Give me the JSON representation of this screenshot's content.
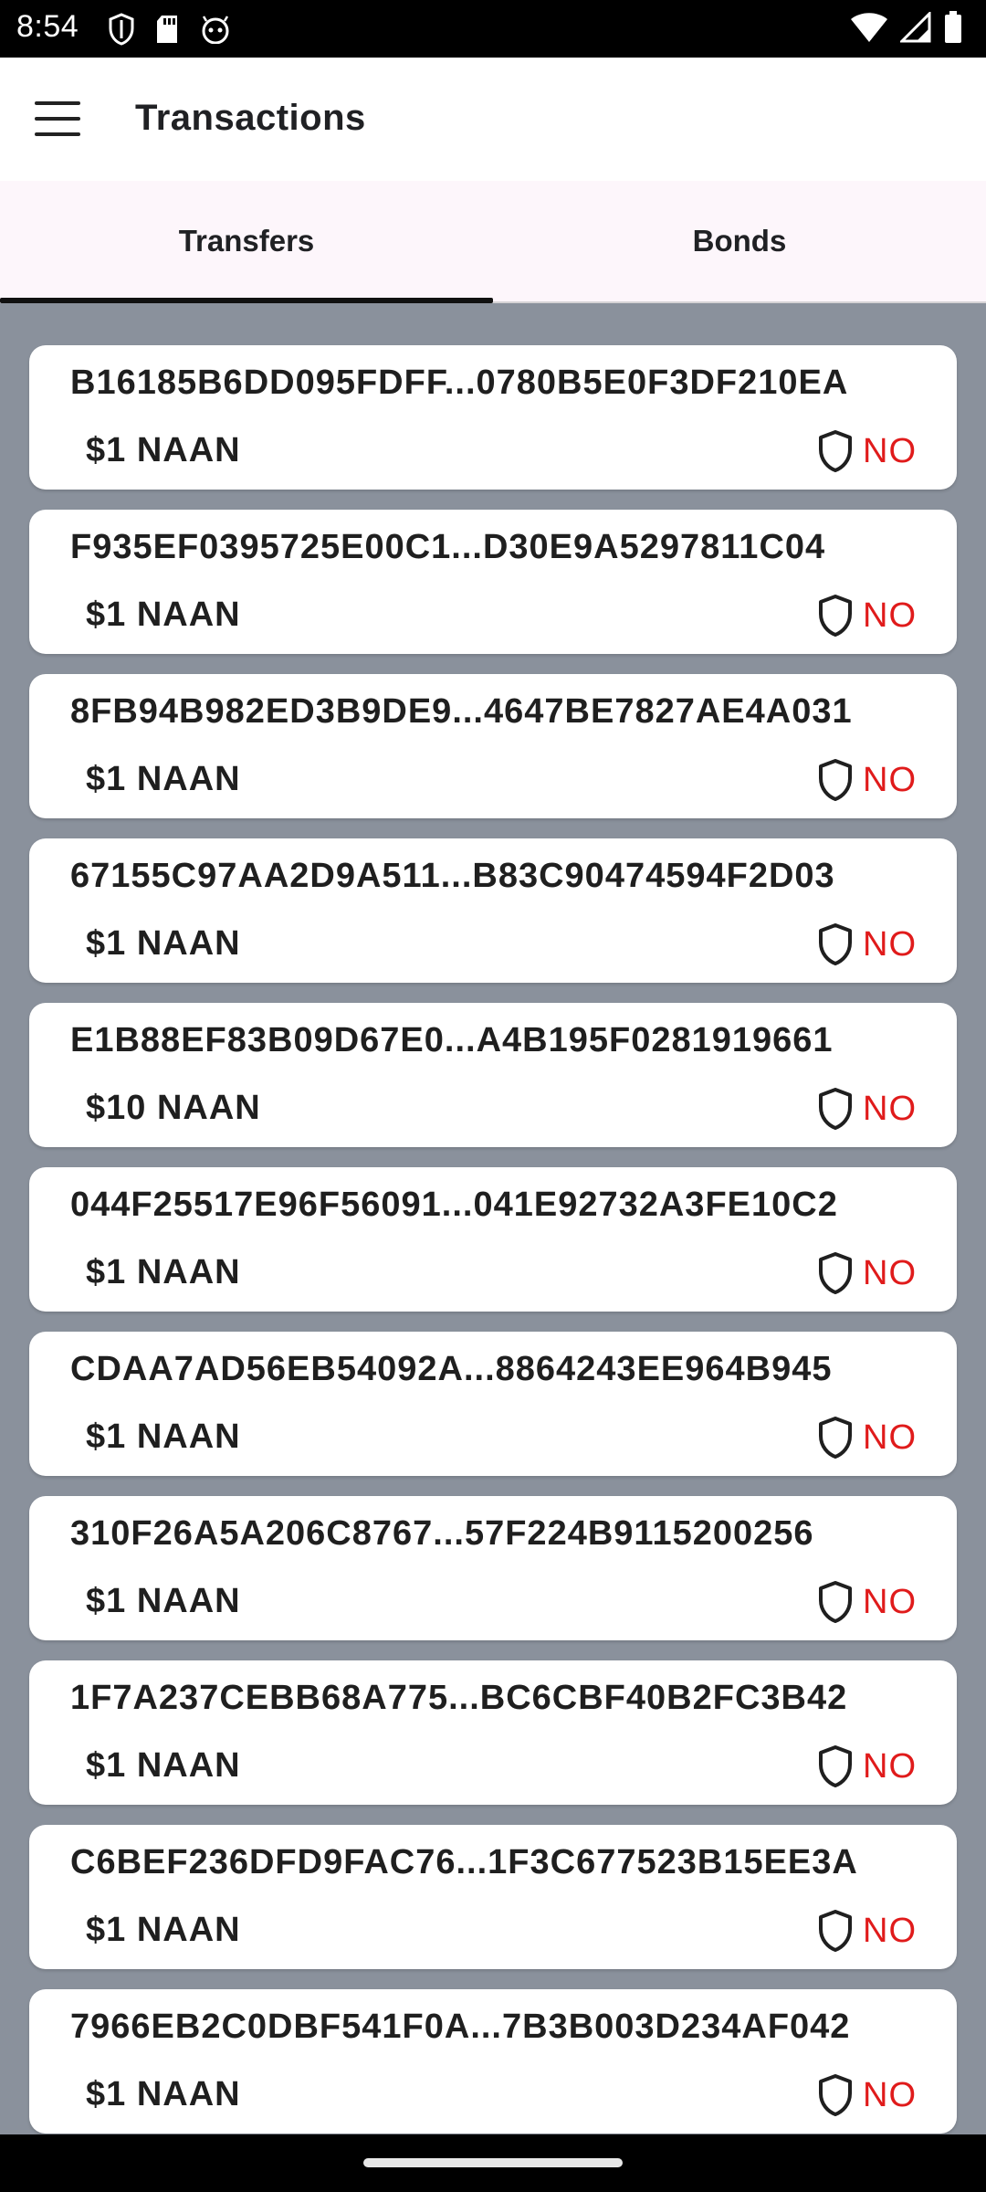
{
  "status_bar": {
    "time": "8:54"
  },
  "app_bar": {
    "title": "Transactions"
  },
  "tabs": [
    {
      "label": "Transfers",
      "active": true
    },
    {
      "label": "Bonds",
      "active": false
    }
  ],
  "transactions": [
    {
      "hash": "B16185B6DD095FDFF...0780B5E0F3DF210EA",
      "amount": "$1 NAAN",
      "status": "NO"
    },
    {
      "hash": "F935EF0395725E00C1...D30E9A5297811C04",
      "amount": "$1 NAAN",
      "status": "NO"
    },
    {
      "hash": "8FB94B982ED3B9DE9...4647BE7827AE4A031",
      "amount": "$1 NAAN",
      "status": "NO"
    },
    {
      "hash": "67155C97AA2D9A511...B83C90474594F2D03",
      "amount": "$1 NAAN",
      "status": "NO"
    },
    {
      "hash": "E1B88EF83B09D67E0...A4B195F0281919661",
      "amount": "$10 NAAN",
      "status": "NO"
    },
    {
      "hash": "044F25517E96F56091...041E92732A3FE10C2",
      "amount": "$1 NAAN",
      "status": "NO"
    },
    {
      "hash": "CDAA7AD56EB54092A...8864243EE964B945",
      "amount": "$1 NAAN",
      "status": "NO"
    },
    {
      "hash": "310F26A5A206C8767...57F224B9115200256",
      "amount": "$1 NAAN",
      "status": "NO"
    },
    {
      "hash": "1F7A237CEBB68A775...BC6CBF40B2FC3B42",
      "amount": "$1 NAAN",
      "status": "NO"
    },
    {
      "hash": "C6BEF236DFD9FAC76...1F3C677523B15EE3A",
      "amount": "$1 NAAN",
      "status": "NO"
    },
    {
      "hash": "7966EB2C0DBF541F0A...7B3B003D234AF042",
      "amount": "$1 NAAN",
      "status": "NO"
    }
  ],
  "colors": {
    "status_no": "#e01b1b",
    "background": "#8a919c",
    "tab_bg": "#fdf6fb"
  },
  "icons": {
    "status": "shield-icon",
    "menu": "hamburger-menu-icon"
  }
}
